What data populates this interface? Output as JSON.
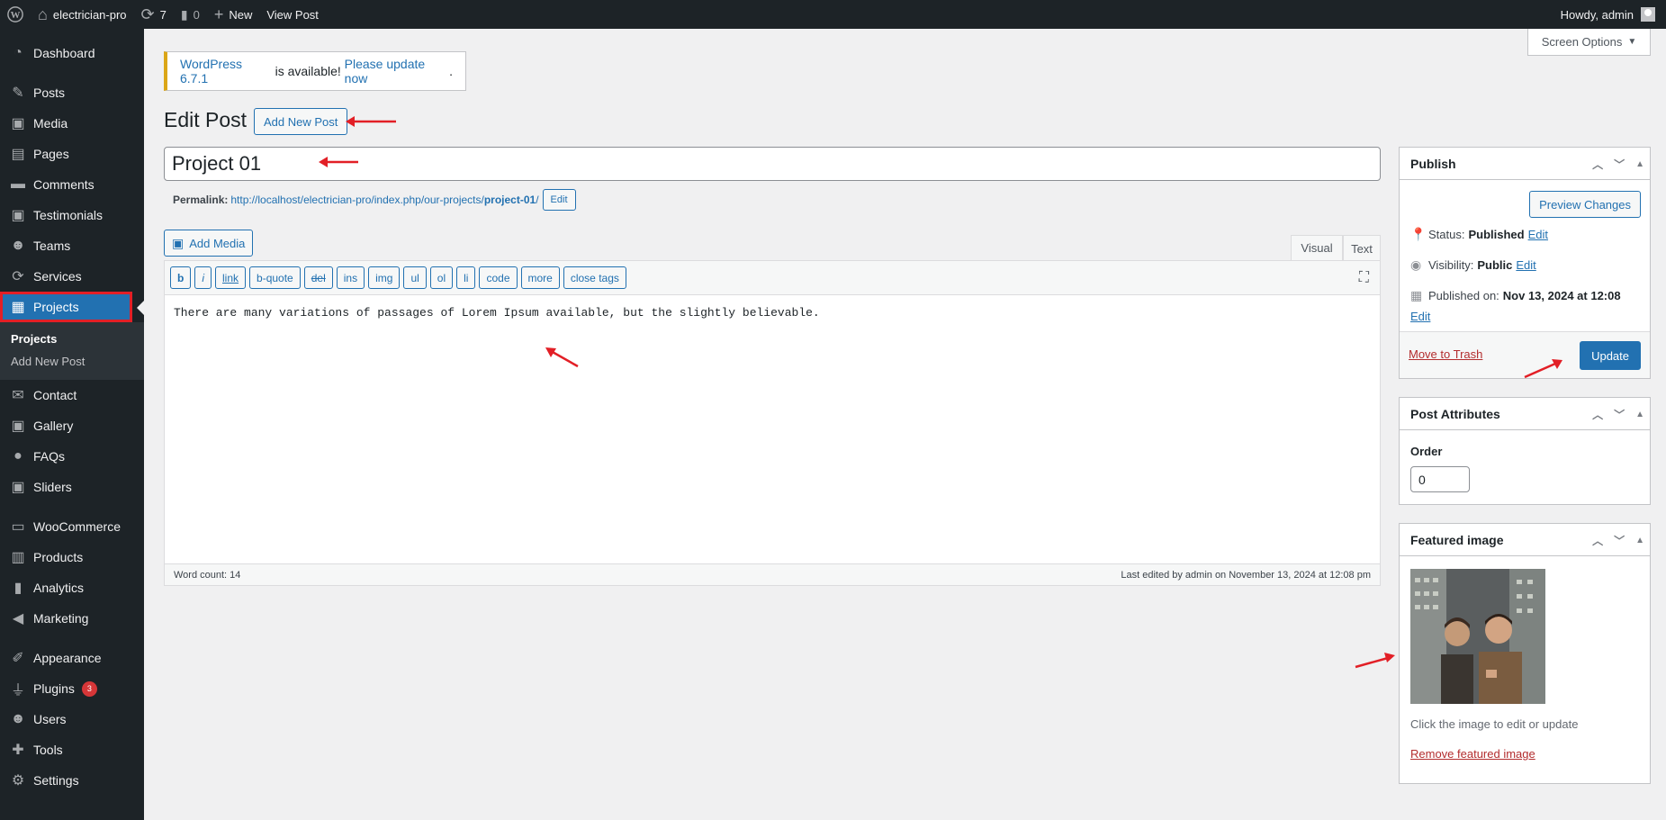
{
  "adminbar": {
    "site_name": "electrician-pro",
    "updates_count": "7",
    "comments_count": "0",
    "new_label": "New",
    "view_post_label": "View Post",
    "howdy": "Howdy, admin"
  },
  "sidebar": {
    "items": [
      {
        "label": "Dashboard",
        "icon": "dashboard-icon"
      },
      {
        "label": "Posts",
        "icon": "pin-icon"
      },
      {
        "label": "Media",
        "icon": "media-icon"
      },
      {
        "label": "Pages",
        "icon": "pages-icon"
      },
      {
        "label": "Comments",
        "icon": "comment-icon"
      },
      {
        "label": "Testimonials",
        "icon": "media-icon"
      },
      {
        "label": "Teams",
        "icon": "groups-icon"
      },
      {
        "label": "Services",
        "icon": "refresh-icon"
      },
      {
        "label": "Projects",
        "icon": "portfolio-icon"
      },
      {
        "label": "Contact",
        "icon": "mail-icon"
      },
      {
        "label": "Gallery",
        "icon": "media-icon"
      },
      {
        "label": "FAQs",
        "icon": "chat-icon"
      },
      {
        "label": "Sliders",
        "icon": "media-icon"
      },
      {
        "label": "WooCommerce",
        "icon": "woo-icon"
      },
      {
        "label": "Products",
        "icon": "archive-icon"
      },
      {
        "label": "Analytics",
        "icon": "chart-icon"
      },
      {
        "label": "Marketing",
        "icon": "megaphone-icon"
      },
      {
        "label": "Appearance",
        "icon": "brush-icon"
      },
      {
        "label": "Plugins",
        "icon": "plug-icon",
        "badge": "3"
      },
      {
        "label": "Users",
        "icon": "user-icon"
      },
      {
        "label": "Tools",
        "icon": "wrench-icon"
      },
      {
        "label": "Settings",
        "icon": "settings-icon"
      }
    ],
    "submenu": [
      "Projects",
      "Add New Post"
    ]
  },
  "screen_options": "Screen Options",
  "notice": {
    "link1": "WordPress 6.7.1",
    "text": " is available! ",
    "link2": "Please update now",
    "end": "."
  },
  "page": {
    "title": "Edit Post",
    "add_new_label": "Add New Post",
    "post_title": "Project 01"
  },
  "permalink": {
    "label": "Permalink:",
    "url_base": "http://localhost/electrician-pro/index.php/our-projects/",
    "slug": "project-01",
    "trailing": "/",
    "edit_label": "Edit"
  },
  "editor": {
    "add_media_label": "Add Media",
    "tab_visual": "Visual",
    "tab_text": "Text",
    "toolbar": [
      "b",
      "i",
      "link",
      "b-quote",
      "del",
      "ins",
      "img",
      "ul",
      "ol",
      "li",
      "code",
      "more",
      "close tags"
    ],
    "content": "There are many variations of passages of Lorem Ipsum available, but the slightly believable.",
    "word_count": "Word count: 14",
    "last_edited": "Last edited by admin on November 13, 2024 at 12:08 pm"
  },
  "publish": {
    "title": "Publish",
    "preview_label": "Preview Changes",
    "status_label": "Status:",
    "status_value": "Published",
    "visibility_label": "Visibility:",
    "visibility_value": "Public",
    "published_label": "Published on:",
    "published_value": "Nov 13, 2024 at 12:08",
    "edit_label": "Edit",
    "trash_label": "Move to Trash",
    "update_label": "Update"
  },
  "attributes": {
    "title": "Post Attributes",
    "order_label": "Order",
    "order_value": "0"
  },
  "featured": {
    "title": "Featured image",
    "help": "Click the image to edit or update",
    "remove_label": "Remove featured image"
  },
  "colors": {
    "admin_dark": "#1d2327",
    "accent": "#2271b1",
    "annotation_red": "#e21f26"
  }
}
